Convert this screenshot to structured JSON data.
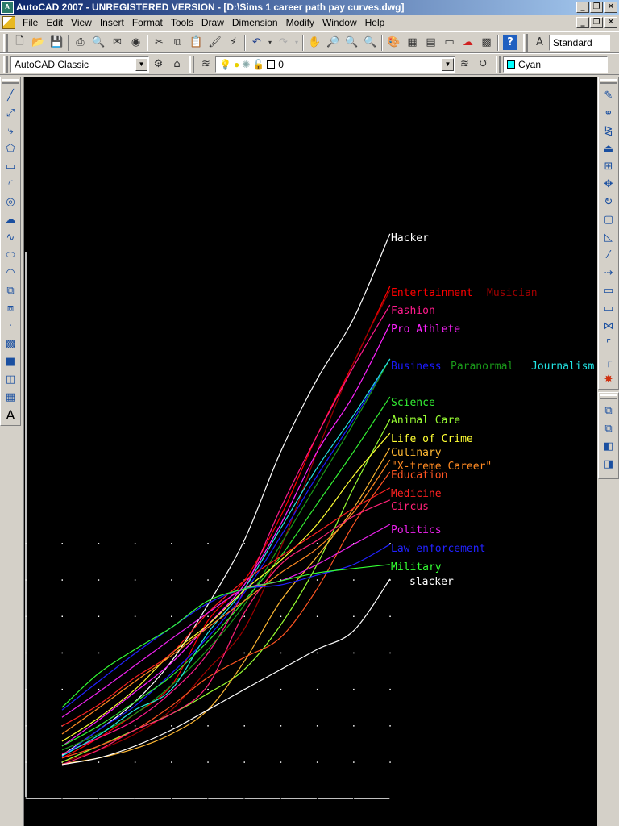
{
  "window": {
    "title": "AutoCAD 2007 - UNREGISTERED VERSION - [D:\\Sims 1 career path pay curves.dwg]",
    "app_icon": "autocad-logo-icon",
    "controls": [
      "minimize",
      "restore",
      "close"
    ]
  },
  "menubar": {
    "items": [
      "File",
      "Edit",
      "View",
      "Insert",
      "Format",
      "Tools",
      "Draw",
      "Dimension",
      "Modify",
      "Window",
      "Help"
    ]
  },
  "toolbar_standard": {
    "icons": [
      "new-icon",
      "open-icon",
      "save-icon",
      "plot-icon",
      "plot-preview-icon",
      "publish-icon",
      "3d-dwf-icon",
      "cut-icon",
      "copy-icon",
      "paste-icon",
      "match-properties-icon",
      "block-editor-icon",
      "undo-icon",
      "redo-icon",
      "pan-icon",
      "zoom-realtime-icon",
      "zoom-window-icon",
      "zoom-previous-icon",
      "properties-icon",
      "design-center-icon",
      "tool-palettes-icon",
      "sheet-set-icon",
      "markup-icon",
      "quickcalc-icon",
      "help-icon"
    ],
    "text_style_icon": "text-style-icon",
    "text_style_value": "Standard"
  },
  "toolbar_workspace": {
    "workspace_value": "AutoCAD Classic",
    "layer_value": "0",
    "color_value": "Cyan",
    "color_swatch": "#00ffff"
  },
  "draw_toolbar": [
    "line-icon",
    "construction-line-icon",
    "polyline-icon",
    "polygon-icon",
    "rectangle-icon",
    "arc-icon",
    "circle-icon",
    "revision-cloud-icon",
    "spline-icon",
    "ellipse-icon",
    "ellipse-arc-icon",
    "insert-block-icon",
    "make-block-icon",
    "point-icon",
    "hatch-icon",
    "gradient-icon",
    "region-icon",
    "table-icon",
    "multiline-text-icon"
  ],
  "modify_toolbar": [
    "erase-icon",
    "copy-object-icon",
    "mirror-icon",
    "offset-icon",
    "array-icon",
    "move-icon",
    "rotate-icon",
    "scale-icon",
    "stretch-icon",
    "trim-icon",
    "extend-icon",
    "break-at-point-icon",
    "break-icon",
    "join-icon",
    "chamfer-icon",
    "fillet-icon",
    "explode-icon"
  ],
  "draworder_toolbar": [
    "bring-to-front-icon",
    "send-to-back-icon",
    "bring-above-icon",
    "send-under-icon"
  ],
  "chart_data": {
    "type": "line",
    "title": "",
    "xlabel": "",
    "ylabel": "",
    "x": [
      1,
      2,
      3,
      4,
      5,
      6,
      7,
      8,
      9,
      10
    ],
    "xlim": [
      0,
      10
    ],
    "ylim": [
      0,
      15
    ],
    "grid": "dots",
    "legend": "labels at line ends (right)",
    "series": [
      {
        "name": "Hacker",
        "color": "#ffffff",
        "values": [
          1.19,
          1.88,
          2.65,
          3.76,
          5.31,
          7.08,
          9.51,
          11.5,
          13.16,
          15.49
        ]
      },
      {
        "name": "Entertainment",
        "color": "#ff0000",
        "values": [
          1.11,
          1.66,
          2.32,
          3.1,
          4.87,
          5.97,
          7.74,
          9.96,
          11.95,
          14.05
        ]
      },
      {
        "name": "Musician",
        "color": "#a00000",
        "values": [
          1.0,
          1.33,
          1.77,
          2.43,
          3.54,
          4.65,
          6.86,
          9.51,
          11.95,
          13.94
        ]
      },
      {
        "name": "Fashion",
        "color": "#ff1a8c",
        "values": [
          1.22,
          1.66,
          2.15,
          2.92,
          3.98,
          5.71,
          7.96,
          9.96,
          11.84,
          13.54
        ]
      },
      {
        "name": "Pro Athlete",
        "color": "#ff22ff",
        "values": [
          1.44,
          2.15,
          2.92,
          3.72,
          4.76,
          5.86,
          7.52,
          9.51,
          11.06,
          13.01
        ]
      },
      {
        "name": "Business",
        "color": "#1a1aff",
        "values": [
          1.15,
          1.88,
          2.54,
          3.43,
          4.42,
          5.64,
          7.19,
          8.85,
          10.4,
          12.06
        ]
      },
      {
        "name": "Paranormal",
        "color": "#1a9a1a",
        "values": [
          1.33,
          1.77,
          2.32,
          3.1,
          4.09,
          5.31,
          6.97,
          8.63,
          10.29,
          12.06
        ]
      },
      {
        "name": "Journalism",
        "color": "#22e5e5",
        "values": [
          1.17,
          1.73,
          2.43,
          2.99,
          4.54,
          5.75,
          7.41,
          9.07,
          10.51,
          12.06
        ]
      },
      {
        "name": "Science",
        "color": "#33ee33",
        "values": [
          1.44,
          1.99,
          2.65,
          3.36,
          4.31,
          5.42,
          6.64,
          8.08,
          9.51,
          11.02
        ]
      },
      {
        "name": "Animal Care",
        "color": "#99ff33",
        "values": [
          1.0,
          1.44,
          1.88,
          2.32,
          2.88,
          3.54,
          4.76,
          6.42,
          8.52,
          10.4
        ]
      },
      {
        "name": "Life of Crime",
        "color": "#ffff33",
        "values": [
          1.57,
          2.21,
          2.99,
          3.98,
          4.76,
          5.71,
          6.53,
          7.52,
          8.85,
          10.02
        ]
      },
      {
        "name": "Culinary",
        "color": "#ffb833",
        "values": [
          0.95,
          1.11,
          1.37,
          1.77,
          2.43,
          3.76,
          5.42,
          6.64,
          7.96,
          9.62
        ]
      },
      {
        "name": "\"X-treme Career\"",
        "color": "#ff8a22",
        "values": [
          1.77,
          2.48,
          3.21,
          3.92,
          4.69,
          5.42,
          6.19,
          6.86,
          7.85,
          9.29
        ]
      },
      {
        "name": "Education",
        "color": "#ff5522",
        "values": [
          1.11,
          1.44,
          1.88,
          2.54,
          3.32,
          3.87,
          4.42,
          5.75,
          7.52,
          8.96
        ]
      },
      {
        "name": "Medicine",
        "color": "#ff2222",
        "values": [
          1.99,
          2.57,
          3.32,
          3.98,
          5.09,
          5.97,
          6.64,
          7.3,
          7.96,
          8.52
        ]
      },
      {
        "name": "Circus",
        "color": "#ff2277",
        "values": [
          0.93,
          1.33,
          1.88,
          2.32,
          3.1,
          5.09,
          6.42,
          7.08,
          7.74,
          8.19
        ]
      },
      {
        "name": "Politics",
        "color": "#ee22ee",
        "values": [
          2.23,
          2.92,
          3.65,
          4.38,
          5.09,
          5.75,
          5.97,
          6.42,
          6.97,
          7.52
        ]
      },
      {
        "name": "Law enforcement",
        "color": "#2222ff",
        "values": [
          2.43,
          3.21,
          3.98,
          4.69,
          5.35,
          5.75,
          5.86,
          6.13,
          6.42,
          6.97
        ]
      },
      {
        "name": "Military",
        "color": "#33ff33",
        "values": [
          2.5,
          3.43,
          4.09,
          4.69,
          5.42,
          5.75,
          5.97,
          6.19,
          6.31,
          6.42
        ]
      },
      {
        "name": "slacker",
        "color": "#ffffff",
        "values": [
          0.93,
          1.11,
          1.44,
          1.88,
          2.43,
          2.99,
          3.54,
          4.09,
          4.6,
          6.02
        ]
      }
    ],
    "labels": [
      {
        "text": "Hacker",
        "color": "#ffffff",
        "series": "Hacker"
      },
      {
        "text": "Entertainment",
        "color": "#ff0000",
        "series": "Entertainment"
      },
      {
        "text": "Musician",
        "color": "#a00000",
        "series": "Musician"
      },
      {
        "text": "Fashion",
        "color": "#ff1a8c",
        "series": "Fashion"
      },
      {
        "text": "Pro Athlete",
        "color": "#ff22ff",
        "series": "Pro Athlete"
      },
      {
        "text": "Business",
        "color": "#1a1aff",
        "series": "Business"
      },
      {
        "text": "Paranormal",
        "color": "#1a9a1a",
        "series": "Paranormal"
      },
      {
        "text": "Journalism",
        "color": "#22e5e5",
        "series": "Journalism"
      },
      {
        "text": "Science",
        "color": "#33ee33",
        "series": "Science"
      },
      {
        "text": "Animal Care",
        "color": "#99ff33",
        "series": "Animal Care"
      },
      {
        "text": "Life of Crime",
        "color": "#ffff33",
        "series": "Life of Crime"
      },
      {
        "text": "Culinary",
        "color": "#ffb833",
        "series": "Culinary"
      },
      {
        "text": "\"X-treme Career\"",
        "color": "#ff8a22",
        "series": "\"X-treme Career\""
      },
      {
        "text": "Education",
        "color": "#ff5522",
        "series": "Education"
      },
      {
        "text": "Medicine",
        "color": "#ff2222",
        "series": "Medicine"
      },
      {
        "text": "Circus",
        "color": "#ff2277",
        "series": "Circus"
      },
      {
        "text": "Politics",
        "color": "#ee22ee",
        "series": "Politics"
      },
      {
        "text": "Law enforcement",
        "color": "#2222ff",
        "series": "Law enforcement"
      },
      {
        "text": "Military",
        "color": "#33ff33",
        "series": "Military"
      },
      {
        "text": "slacker",
        "color": "#ffffff",
        "series": "slacker"
      }
    ]
  }
}
